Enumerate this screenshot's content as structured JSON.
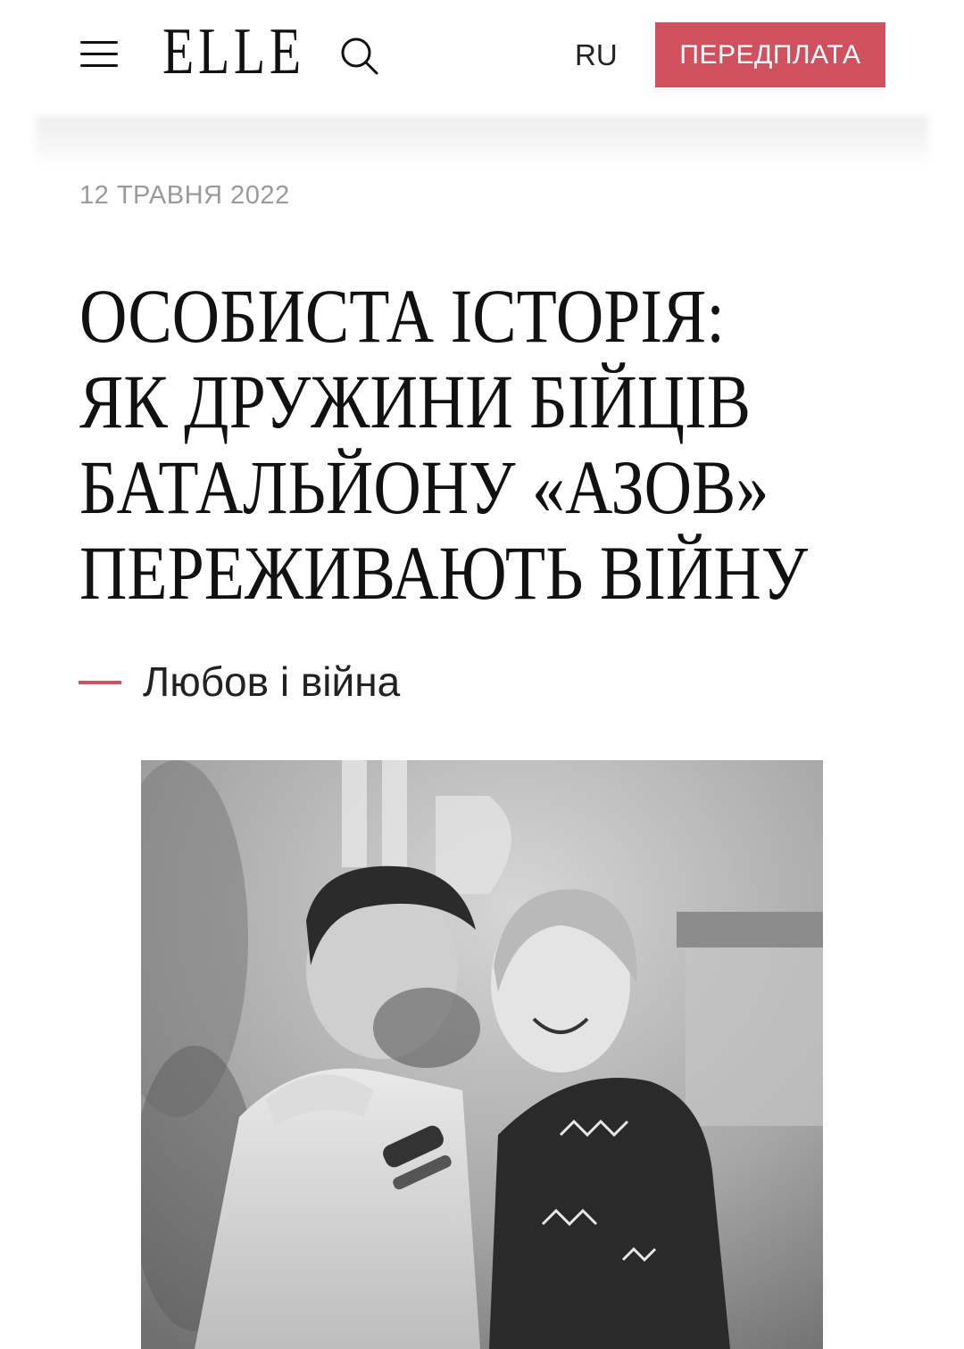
{
  "header": {
    "logo": "ELLE",
    "lang": "RU",
    "subscribe_label": "ПЕРЕДПЛАТА"
  },
  "article": {
    "date": "12 ТРАВНЯ 2022",
    "title_lines": [
      "ОСОБИСТА ІСТОРІЯ:",
      "ЯК ДРУЖИНИ БІЙЦІВ",
      "БАТАЛЬЙОНУ «АЗОВ»",
      "ПЕРЕЖИВАЮТЬ ВІЙНУ"
    ],
    "rubric": "Любов і війна"
  },
  "colors": {
    "accent": "#d1505e",
    "date": "#9a9a9a",
    "text": "#111111"
  },
  "icons": [
    "menu-icon",
    "search-icon"
  ]
}
